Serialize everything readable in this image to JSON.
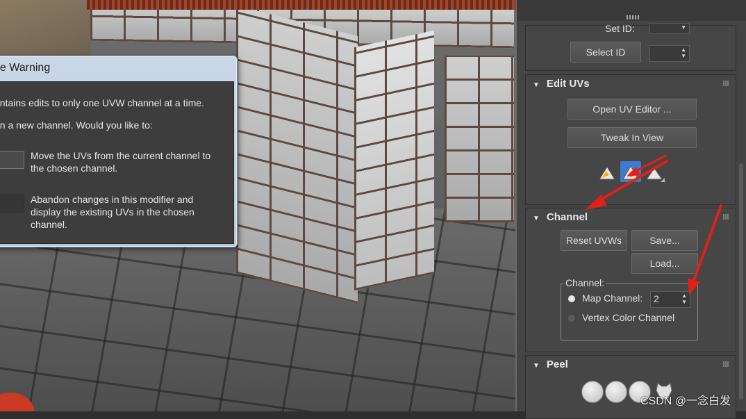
{
  "dialog": {
    "title": "ge Warning",
    "line1": "ontains edits to only one UVW channel at a time.",
    "line2": "en a new channel. Would you like to:",
    "option_move": [
      "Move the UVs from the current channel to",
      "the chosen channel."
    ],
    "option_abandon": [
      "Abandon changes in this modifier and",
      "display the existing UVs in the chosen",
      "channel."
    ]
  },
  "panel": {
    "set_id_label": "Set ID:",
    "select_id_label": "Select ID",
    "edit_uvs": {
      "title": "Edit UVs",
      "open_uv_editor": "Open UV Editor ...",
      "tweak_in_view": "Tweak In View",
      "tool_icons": [
        "uv-pin-icon",
        "uv-tweak-icon",
        "uv-snap-icon"
      ]
    },
    "channel": {
      "title": "Channel",
      "reset_uvws": "Reset UVWs",
      "save": "Save...",
      "load": "Load...",
      "group_title": "Channel:",
      "map_channel_label": "Map Channel:",
      "map_channel_value": "2",
      "vertex_color_label": "Vertex Color Channel",
      "selected": "map"
    },
    "peel": {
      "title": "Peel",
      "tool_icons": [
        "peel-quick-icon",
        "peel-mode-icon",
        "peel-seams-icon",
        "peel-pelt-icon"
      ]
    }
  },
  "watermark": "CSDN @一念白发",
  "colors": {
    "annotation_arrow": "#e0201a",
    "panel_bg": "#444444",
    "dialog_frame": "#b8c8db"
  }
}
